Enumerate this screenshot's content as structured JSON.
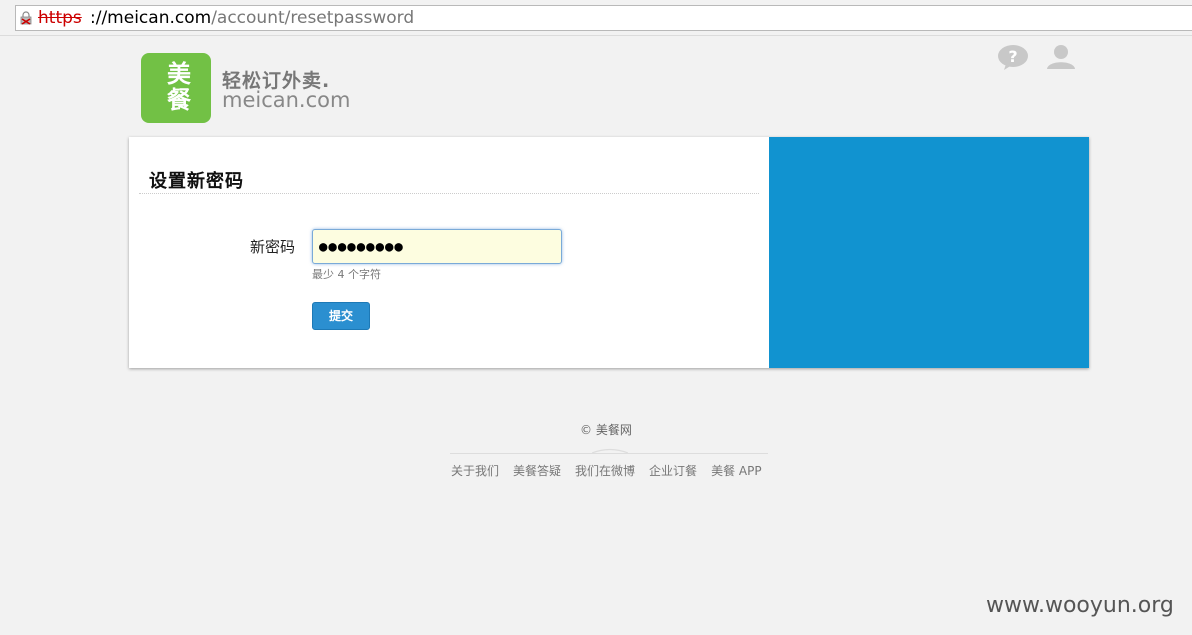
{
  "browser": {
    "url_scheme": "https",
    "url_host": "://meican.com",
    "url_path": "/account/resetpassword"
  },
  "header": {
    "logo_chars": [
      "美",
      "餐"
    ],
    "slogan": "轻松订外卖.",
    "domain": "meican.com",
    "icons": [
      "help-icon",
      "user-icon"
    ]
  },
  "form": {
    "title": "设置新密码",
    "password_label": "新密码",
    "password_value": "●●●●●●●●●",
    "password_hint": "最少 4 个字符",
    "submit_label": "提交"
  },
  "footer": {
    "copyright": "© 美餐网",
    "links": [
      "关于我们",
      "美餐答疑",
      "我们在微博",
      "企业订餐",
      "美餐 APP"
    ]
  },
  "watermark": "www.wooyun.org",
  "colors": {
    "brand_green": "#72c145",
    "panel_blue": "#1193d0",
    "button_blue": "#2b8fd0",
    "input_bg": "#fdfde0"
  }
}
